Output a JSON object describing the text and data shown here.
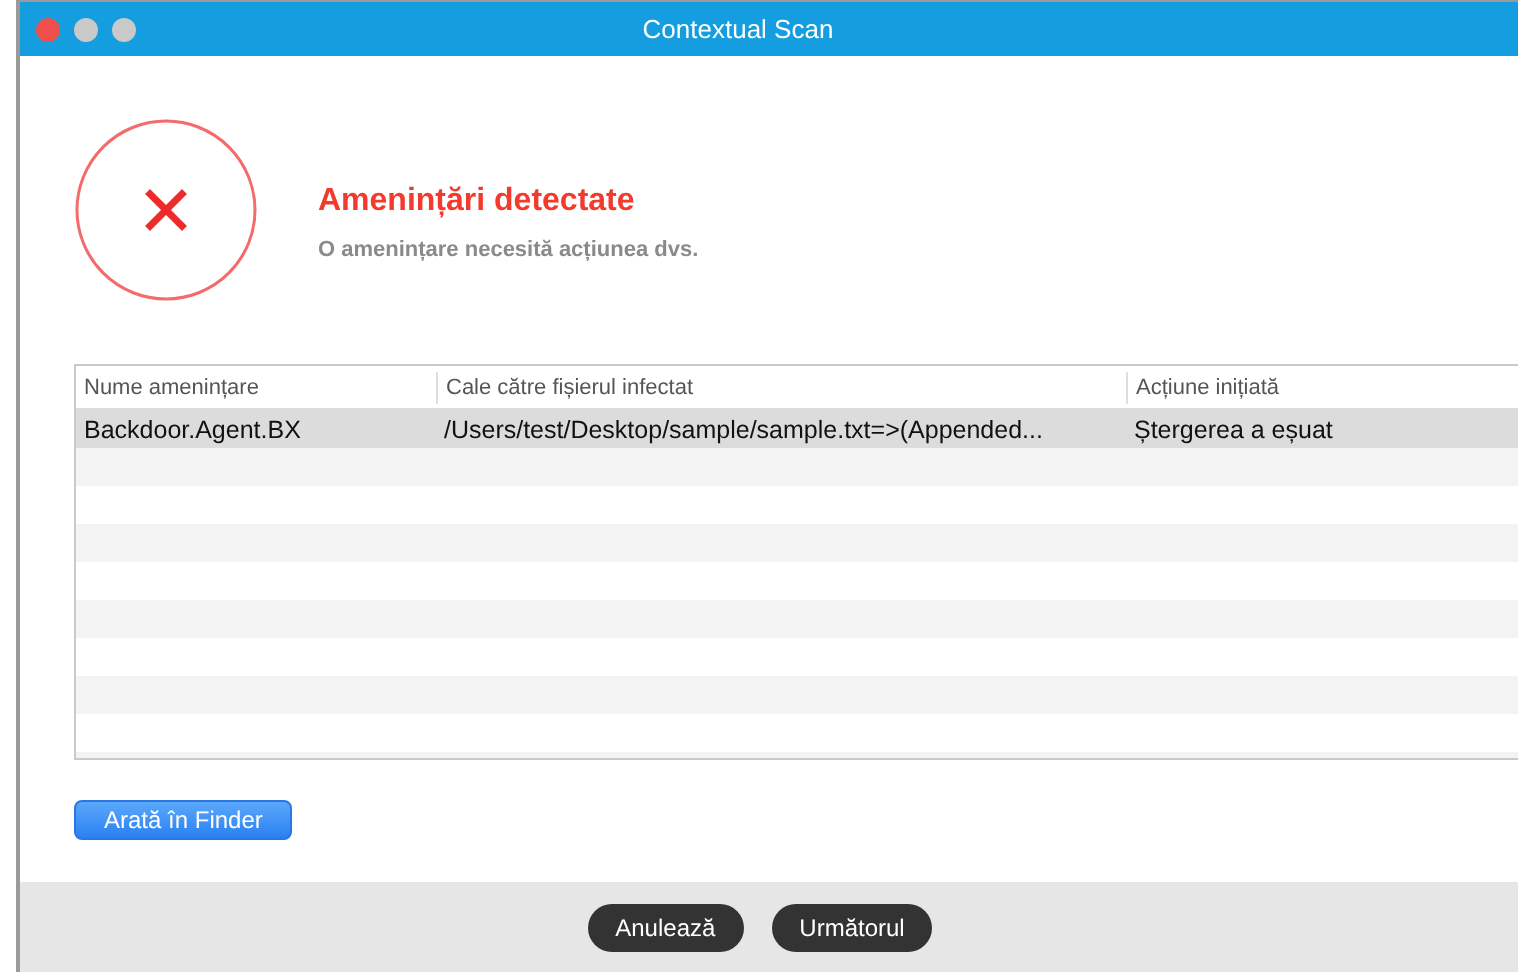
{
  "window": {
    "title": "Contextual Scan"
  },
  "header": {
    "title": "Amenințări detectate",
    "subtitle": "O amenințare necesită acțiunea dvs."
  },
  "table": {
    "columns": [
      "Nume amenințare",
      "Cale către fișierul infectat",
      "Acțiune inițiată"
    ],
    "rows": [
      {
        "cells": [
          "Backdoor.Agent.BX",
          "/Users/test/Desktop/sample/sample.txt=>(Appended...",
          "Ștergerea a eșuat"
        ],
        "selected": true
      }
    ]
  },
  "finder_button": "Arată în Finder",
  "buttons": [
    "Anulează",
    "Următorul"
  ]
}
